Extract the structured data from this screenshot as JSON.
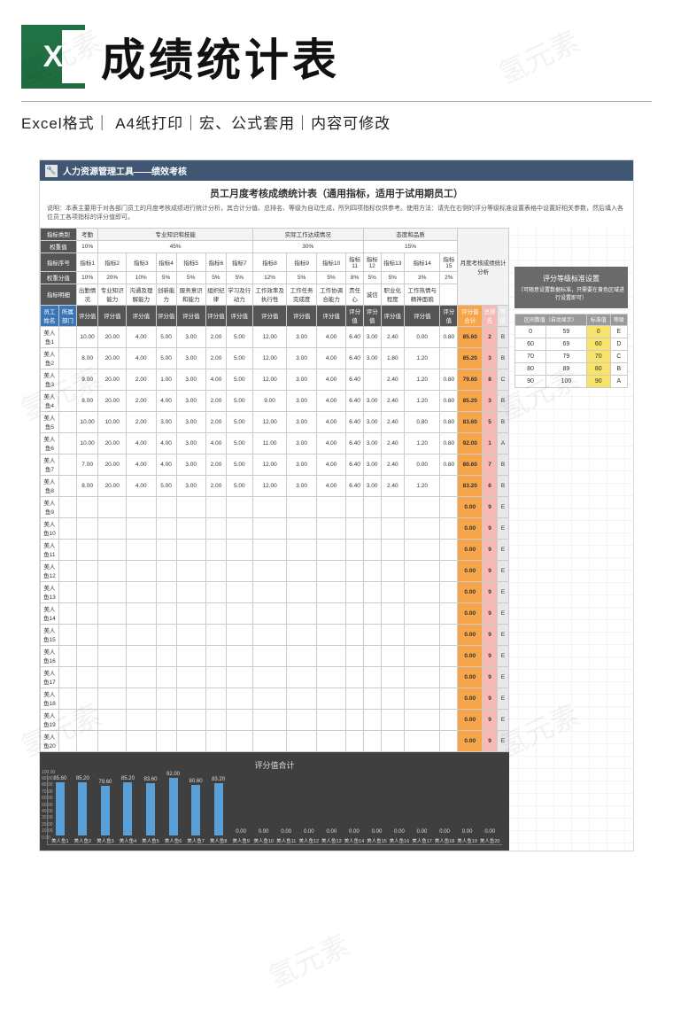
{
  "banner": {
    "title": "成绩统计表",
    "meta": "Excel格式｜ A4纸打印｜宏、公式套用｜内容可修改"
  },
  "sheet": {
    "header": "人力资源管理工具——绩效考核",
    "title": "员工月度考核成绩统计表（通用指标，适用于试用期员工）",
    "desc": "说明：本表主要用于对各部门员工的月度考核成绩进行统计分析，其合计分值、总排名、等级为自动生成，所列四项指标仅供参考。使用方法：请先在右侧的评分等级标准设置表格中设置好相关参数，然后填入各位员工各项指标的评分值即可。"
  },
  "header_rows": {
    "cat_row": [
      "指标类别",
      "考勤",
      "专业知识和技能",
      "实际工作达成情况",
      "态度和品质",
      "月度考核成绩统计分析"
    ],
    "weight_row": [
      "权重值",
      "10%",
      "45%",
      "30%",
      "15%"
    ],
    "index_row": [
      "指标序号",
      "指标1",
      "指标2",
      "指标3",
      "指标4",
      "指标5",
      "指标6",
      "指标7",
      "指标8",
      "指标9",
      "指标10",
      "指标11",
      "指标12",
      "指标13",
      "指标14",
      "指标15"
    ],
    "pct_row": [
      "权重分值",
      "10%",
      "20%",
      "10%",
      "5%",
      "5%",
      "5%",
      "5%",
      "12%",
      "5%",
      "5%",
      "8%",
      "5%",
      "5%",
      "3%",
      "2%"
    ],
    "name_row": [
      "指标明细",
      "出勤情况",
      "专业知识能力",
      "沟通及理解能力",
      "创新能力",
      "服务意识和能力",
      "组织纪律",
      "学习及行动力",
      "工作效率及执行性",
      "工作任务完成度",
      "工作协调合能力",
      "责任心",
      "诚信",
      "职业化程度",
      "工作热情与精神面貌"
    ],
    "score_row": [
      "员工姓名",
      "所属部门",
      "评分值",
      "评分值",
      "评分值",
      "评分值",
      "评分值",
      "评分值",
      "评分值",
      "评分值",
      "评分值",
      "评分值",
      "评分值",
      "评分值",
      "评分值",
      "评分值",
      "评分值"
    ],
    "sum_cols": [
      "评分值合计",
      "总排名",
      "等级"
    ]
  },
  "employees": [
    {
      "name": "美人鱼1",
      "v": [
        "10.00",
        "20.00",
        "4.00",
        "5.00",
        "3.00",
        "2.00",
        "5.00",
        "12.00",
        "3.00",
        "4.00",
        "6.40",
        "3.00",
        "2.40",
        "0.00",
        "0.80"
      ],
      "total": "85.60",
      "rank": "2",
      "grade": "B"
    },
    {
      "name": "美人鱼2",
      "v": [
        "8.00",
        "20.00",
        "4.00",
        "5.00",
        "3.00",
        "2.00",
        "5.00",
        "12.00",
        "3.00",
        "4.00",
        "6.40",
        "3.00",
        "1.80",
        "1.20",
        ""
      ],
      "total": "85.20",
      "rank": "3",
      "grade": "B"
    },
    {
      "name": "美人鱼3",
      "v": [
        "9.00",
        "20.00",
        "2.00",
        "1.00",
        "3.00",
        "4.00",
        "5.00",
        "12.00",
        "3.00",
        "4.00",
        "6.40",
        "",
        "2.40",
        "1.20",
        "0.80"
      ],
      "total": "79.60",
      "rank": "8",
      "grade": "C"
    },
    {
      "name": "美人鱼4",
      "v": [
        "8.00",
        "20.00",
        "2.00",
        "4.00",
        "3.00",
        "2.00",
        "5.00",
        "9.00",
        "3.00",
        "4.00",
        "6.40",
        "3.00",
        "2.40",
        "1.20",
        "0.80"
      ],
      "total": "85.20",
      "rank": "3",
      "grade": "B"
    },
    {
      "name": "美人鱼5",
      "v": [
        "10.00",
        "10.00",
        "2.00",
        "3.00",
        "3.00",
        "2.00",
        "5.00",
        "12.00",
        "3.00",
        "4.00",
        "6.40",
        "3.00",
        "2.40",
        "0.80",
        "0.80"
      ],
      "total": "83.60",
      "rank": "5",
      "grade": "B"
    },
    {
      "name": "美人鱼6",
      "v": [
        "10.00",
        "20.00",
        "4.00",
        "4.00",
        "3.00",
        "4.00",
        "5.00",
        "11.00",
        "3.00",
        "4.00",
        "6.40",
        "3.00",
        "2.40",
        "1.20",
        "0.80"
      ],
      "total": "92.00",
      "rank": "1",
      "grade": "A"
    },
    {
      "name": "美人鱼7",
      "v": [
        "7.00",
        "20.00",
        "4.00",
        "4.00",
        "3.00",
        "2.00",
        "5.00",
        "12.00",
        "3.00",
        "4.00",
        "6.40",
        "3.00",
        "2.40",
        "0.00",
        "0.80"
      ],
      "total": "80.60",
      "rank": "7",
      "grade": "B"
    },
    {
      "name": "美人鱼8",
      "v": [
        "8.00",
        "20.00",
        "4.00",
        "5.00",
        "3.00",
        "2.00",
        "5.00",
        "12.00",
        "3.00",
        "4.00",
        "6.40",
        "3.00",
        "2.40",
        "1.20",
        ""
      ],
      "total": "83.20",
      "rank": "6",
      "grade": "B"
    },
    {
      "name": "美人鱼9",
      "v": [
        "",
        "",
        "",
        "",
        "",
        "",
        "",
        "",
        "",
        "",
        "",
        "",
        "",
        "",
        ""
      ],
      "total": "0.00",
      "rank": "9",
      "grade": "E"
    },
    {
      "name": "美人鱼10",
      "v": [
        "",
        "",
        "",
        "",
        "",
        "",
        "",
        "",
        "",
        "",
        "",
        "",
        "",
        "",
        ""
      ],
      "total": "0.00",
      "rank": "9",
      "grade": "E"
    },
    {
      "name": "美人鱼11",
      "v": [
        "",
        "",
        "",
        "",
        "",
        "",
        "",
        "",
        "",
        "",
        "",
        "",
        "",
        "",
        ""
      ],
      "total": "0.00",
      "rank": "9",
      "grade": "E"
    },
    {
      "name": "美人鱼12",
      "v": [
        "",
        "",
        "",
        "",
        "",
        "",
        "",
        "",
        "",
        "",
        "",
        "",
        "",
        "",
        ""
      ],
      "total": "0.00",
      "rank": "9",
      "grade": "E"
    },
    {
      "name": "美人鱼13",
      "v": [
        "",
        "",
        "",
        "",
        "",
        "",
        "",
        "",
        "",
        "",
        "",
        "",
        "",
        "",
        ""
      ],
      "total": "0.00",
      "rank": "9",
      "grade": "E"
    },
    {
      "name": "美人鱼14",
      "v": [
        "",
        "",
        "",
        "",
        "",
        "",
        "",
        "",
        "",
        "",
        "",
        "",
        "",
        "",
        ""
      ],
      "total": "0.00",
      "rank": "9",
      "grade": "E"
    },
    {
      "name": "美人鱼15",
      "v": [
        "",
        "",
        "",
        "",
        "",
        "",
        "",
        "",
        "",
        "",
        "",
        "",
        "",
        "",
        ""
      ],
      "total": "0.00",
      "rank": "9",
      "grade": "E"
    },
    {
      "name": "美人鱼16",
      "v": [
        "",
        "",
        "",
        "",
        "",
        "",
        "",
        "",
        "",
        "",
        "",
        "",
        "",
        "",
        ""
      ],
      "total": "0.00",
      "rank": "9",
      "grade": "E"
    },
    {
      "name": "美人鱼17",
      "v": [
        "",
        "",
        "",
        "",
        "",
        "",
        "",
        "",
        "",
        "",
        "",
        "",
        "",
        "",
        ""
      ],
      "total": "0.00",
      "rank": "9",
      "grade": "E"
    },
    {
      "name": "美人鱼18",
      "v": [
        "",
        "",
        "",
        "",
        "",
        "",
        "",
        "",
        "",
        "",
        "",
        "",
        "",
        "",
        ""
      ],
      "total": "0.00",
      "rank": "9",
      "grade": "E"
    },
    {
      "name": "美人鱼19",
      "v": [
        "",
        "",
        "",
        "",
        "",
        "",
        "",
        "",
        "",
        "",
        "",
        "",
        "",
        "",
        ""
      ],
      "total": "0.00",
      "rank": "9",
      "grade": "E"
    },
    {
      "name": "美人鱼20",
      "v": [
        "",
        "",
        "",
        "",
        "",
        "",
        "",
        "",
        "",
        "",
        "",
        "",
        "",
        "",
        ""
      ],
      "total": "0.00",
      "rank": "9",
      "grade": "E"
    }
  ],
  "grade_panel": {
    "title": "评分等级标准设置",
    "sub": "（可随意设置数据标准，只需要在黄色区域进行设置即可）",
    "headers": [
      "区间数值（自动显示）",
      "标准值",
      "等级"
    ],
    "rows": [
      [
        "0",
        "59",
        "0",
        "E"
      ],
      [
        "60",
        "69",
        "60",
        "D"
      ],
      [
        "70",
        "79",
        "70",
        "C"
      ],
      [
        "80",
        "89",
        "80",
        "B"
      ],
      [
        "90",
        "100",
        "90",
        "A"
      ]
    ]
  },
  "chart_data": {
    "type": "bar",
    "title": "评分值合计",
    "ylim": [
      0,
      100
    ],
    "yticks": [
      "100.00",
      "90.00",
      "80.00",
      "70.00",
      "60.00",
      "50.00",
      "40.00",
      "30.00",
      "20.00",
      "10.00",
      "0.00"
    ],
    "categories": [
      "美人鱼1",
      "美人鱼2",
      "美人鱼3",
      "美人鱼4",
      "美人鱼5",
      "美人鱼6",
      "美人鱼7",
      "美人鱼8",
      "美人鱼9",
      "美人鱼10",
      "美人鱼11",
      "美人鱼12",
      "美人鱼13",
      "美人鱼14",
      "美人鱼15",
      "美人鱼16",
      "美人鱼17",
      "美人鱼18",
      "美人鱼19",
      "美人鱼20"
    ],
    "values": [
      85.6,
      85.2,
      79.6,
      85.2,
      83.6,
      92.0,
      80.6,
      83.2,
      0,
      0,
      0,
      0,
      0,
      0,
      0,
      0,
      0,
      0,
      0,
      0
    ]
  },
  "watermark": "氢元素"
}
